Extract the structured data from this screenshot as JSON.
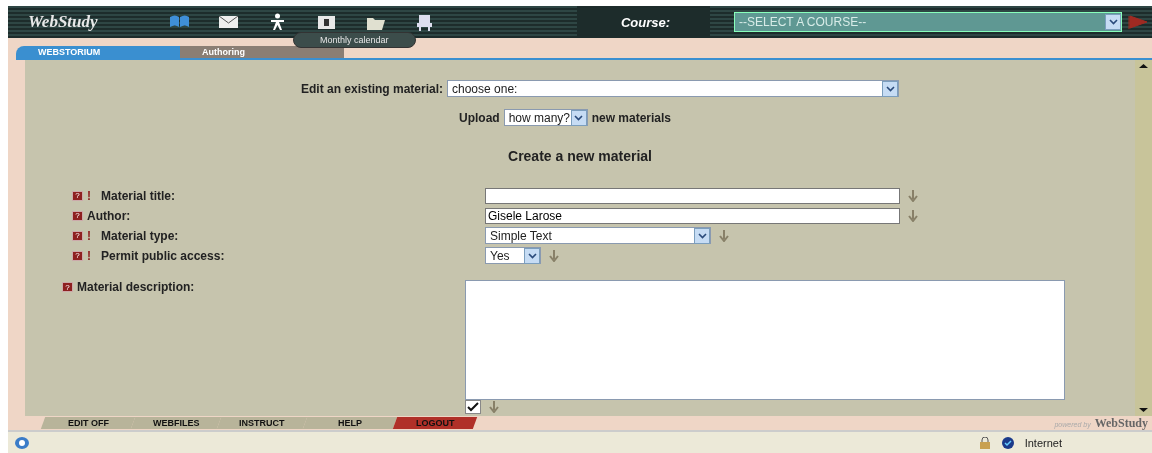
{
  "header": {
    "logo": "WebStudy",
    "calendar_button": "Monthly calendar",
    "course_label": "Course:",
    "course_select": "--SELECT A COURSE--"
  },
  "tabs": [
    {
      "label": "WEBSTORIUM",
      "selected": true
    },
    {
      "label": "Authoring",
      "selected": false
    }
  ],
  "edit_existing": {
    "label": "Edit an existing material:",
    "value": "choose one:"
  },
  "upload": {
    "label": "Upload",
    "value": "how many?",
    "suffix": "new materials"
  },
  "heading": "Create a new material",
  "fields": [
    {
      "label": "Material title:",
      "kind": "text",
      "help": "?",
      "required_mark": "!"
    },
    {
      "label": "Author:",
      "kind": "text",
      "help": "?",
      "value": "Gisele Larose"
    },
    {
      "label": "Material type:",
      "kind": "select",
      "help": "?",
      "required_mark": "!",
      "value": "Simple Text"
    },
    {
      "label": "Permit public access:",
      "kind": "small-select",
      "help": "?",
      "required_mark": "!",
      "value": "Yes"
    },
    {
      "label": "Material description:",
      "kind": "textarea",
      "help": "?"
    }
  ],
  "bottom_tabs": [
    {
      "label": "EDIT OFF",
      "color": "#b8b49a"
    },
    {
      "label": "WEBFILES",
      "color": "#b8b49a"
    },
    {
      "label": "INSTRUCT",
      "color": "#b8b49a"
    },
    {
      "label": "HELP",
      "color": "#b8b49a"
    },
    {
      "label": "LOGOUT",
      "color": "#b03028"
    }
  ],
  "powered_by": {
    "prefix": "powered by",
    "logo": "WebStudy"
  },
  "status_bar": {
    "zone": "Internet"
  }
}
